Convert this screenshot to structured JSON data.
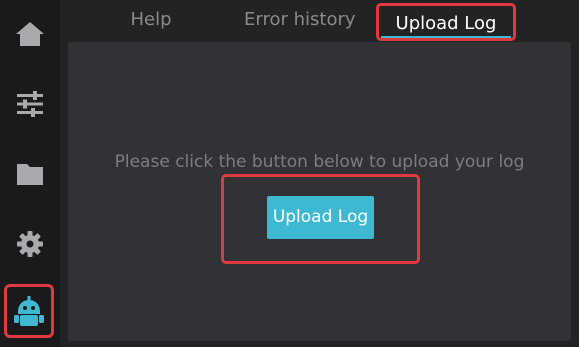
{
  "sidebar": {
    "items": [
      {
        "icon": "home-icon"
      },
      {
        "icon": "sliders-icon"
      },
      {
        "icon": "folder-icon"
      },
      {
        "icon": "gear-icon"
      },
      {
        "icon": "robot-icon"
      }
    ]
  },
  "tabs": [
    {
      "label": "Help"
    },
    {
      "label": "Error history"
    },
    {
      "label": "Upload Log"
    }
  ],
  "main": {
    "prompt": "Please click the button below to upload your log",
    "upload_button_label": "Upload Log"
  },
  "colors": {
    "accent": "#3fb8d2",
    "highlight": "#e0393e",
    "background": "#232326",
    "panel": "#323236"
  }
}
